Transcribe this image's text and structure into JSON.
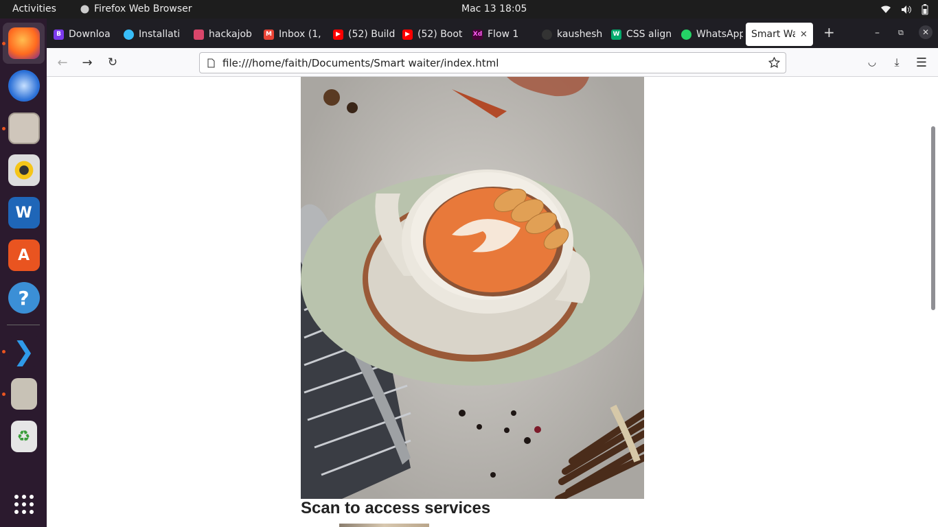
{
  "system_bar": {
    "activities": "Activities",
    "app_name": "Firefox Web Browser",
    "clock": "Mac 13  18:05"
  },
  "dock": {
    "items": [
      "firefox-icon",
      "thunderbird-icon",
      "files-icon",
      "rhythmbox-icon",
      "writer-icon",
      "app-center-icon",
      "help-icon",
      "vscode-icon",
      "archive-icon",
      "trash-icon",
      "app-grid-icon"
    ]
  },
  "tabs": [
    {
      "label": "Downloa",
      "icon": "bootstrap-icon",
      "color": "#7c3aed"
    },
    {
      "label": "Installati",
      "icon": "tailwind-icon",
      "color": "#38bdf8"
    },
    {
      "label": "hackajob",
      "icon": "hackajob-icon",
      "color": "#d9466a"
    },
    {
      "label": "Inbox (1,",
      "icon": "gmail-icon",
      "color": "#ea4335"
    },
    {
      "label": "(52) Build",
      "icon": "youtube-icon",
      "color": "#ff0000"
    },
    {
      "label": "(52) Boot",
      "icon": "youtube-icon",
      "color": "#ff0000"
    },
    {
      "label": "Flow 1",
      "icon": "xd-icon",
      "color": "#470137"
    },
    {
      "label": "kaushesh",
      "icon": "github-icon",
      "color": "#333"
    },
    {
      "label": "CSS align",
      "icon": "w3-icon",
      "color": "#04aa6d"
    },
    {
      "label": "WhatsApp",
      "icon": "whatsapp-icon",
      "color": "#25d366"
    },
    {
      "label": "Smart Wa",
      "icon": "",
      "color": "#fff"
    }
  ],
  "url": "file:///home/faith/Documents/Smart waiter/index.html",
  "page": {
    "heading": "Scan to access services"
  }
}
